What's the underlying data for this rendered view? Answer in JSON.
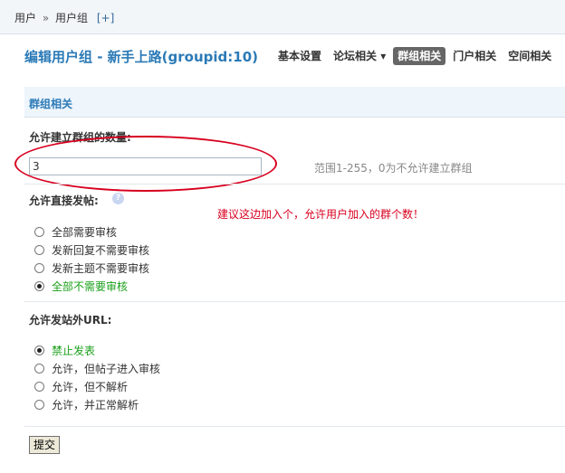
{
  "breadcrumb": {
    "part1": "用户",
    "separator": "»",
    "part2": "用户组",
    "plus": "[+]"
  },
  "header": {
    "title": "编辑用户组 - 新手上路(groupid:10)",
    "tabs": [
      {
        "label": "基本设置"
      },
      {
        "label": "论坛相关 ▾"
      },
      {
        "label": "群组相关"
      },
      {
        "label": "门户相关"
      },
      {
        "label": "空间相关"
      }
    ]
  },
  "section": {
    "title": "群组相关"
  },
  "field_group_count": {
    "label": "允许建立群组的数量:",
    "value": "3",
    "tip": "范围1-255，0为不允许建立群组"
  },
  "annotation": {
    "note": "建议这边加入个，允许用户加入的群个数！"
  },
  "field_direct_post": {
    "label": "允许直接发帖:",
    "help_icon": "question-icon",
    "options": [
      {
        "label": "全部需要审核",
        "selected": false
      },
      {
        "label": "发新回复不需要审核",
        "selected": false
      },
      {
        "label": "发新主题不需要审核",
        "selected": false
      },
      {
        "label": "全部不需要审核",
        "selected": true
      }
    ]
  },
  "field_external_url": {
    "label": "允许发站外URL:",
    "options": [
      {
        "label": "禁止发表",
        "selected": true
      },
      {
        "label": "允许，但帖子进入审核",
        "selected": false
      },
      {
        "label": "允许，但不解析",
        "selected": false
      },
      {
        "label": "允许，并正常解析",
        "selected": false
      }
    ]
  },
  "submit": {
    "label": "提交"
  },
  "colors": {
    "accent": "#2b7ab7",
    "annotation": "#d8001f",
    "selected_option": "#1aa01a"
  }
}
